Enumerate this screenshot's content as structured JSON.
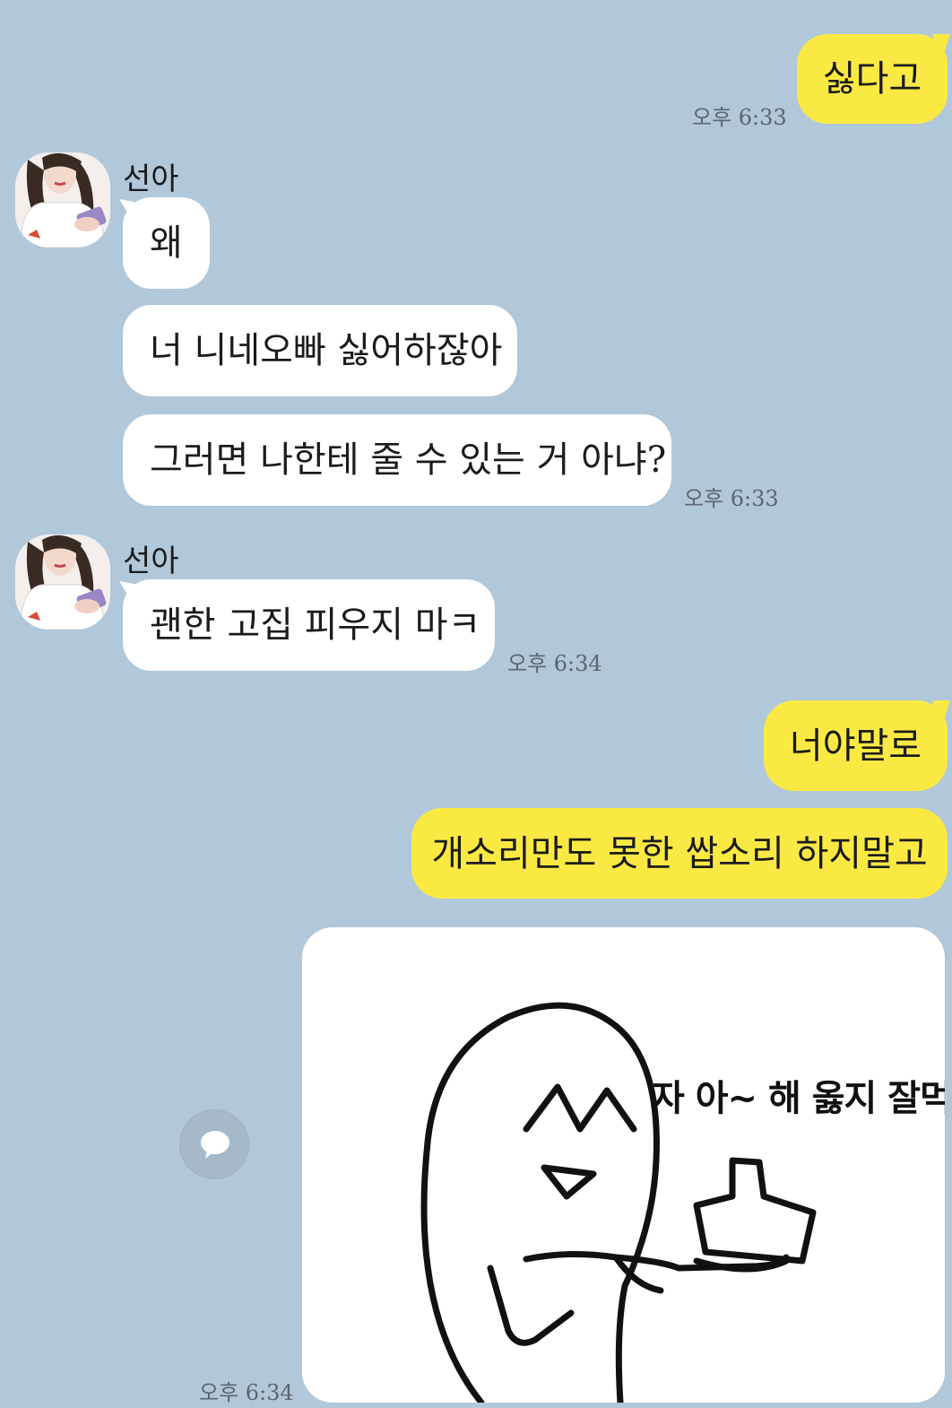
{
  "messages": [
    {
      "text": "싫다고"
    },
    {
      "text": "왜"
    },
    {
      "text": "너 니네오빠 싫어하잖아"
    },
    {
      "text": "그러면 나한테 줄 수 있는 거 아냐?"
    },
    {
      "text": "괜한 고집 피우지 마ㅋ"
    },
    {
      "text": "너야말로"
    },
    {
      "text": "개소리만도 못한 쌉소리 하지말고"
    }
  ],
  "sender_name": "선아",
  "times": {
    "t1": "오후 6:33",
    "t2": "오후 6:33",
    "t3": "오후 6:34",
    "t4": "오후 6:34"
  },
  "sticker": {
    "caption": "자 아~ 해 옳지 잘먹는다"
  },
  "colors": {
    "background": "#b1c7da",
    "my_bubble": "#fbe943",
    "their_bubble": "#ffffff"
  },
  "icons": {
    "share": "speech-bubble-icon"
  }
}
